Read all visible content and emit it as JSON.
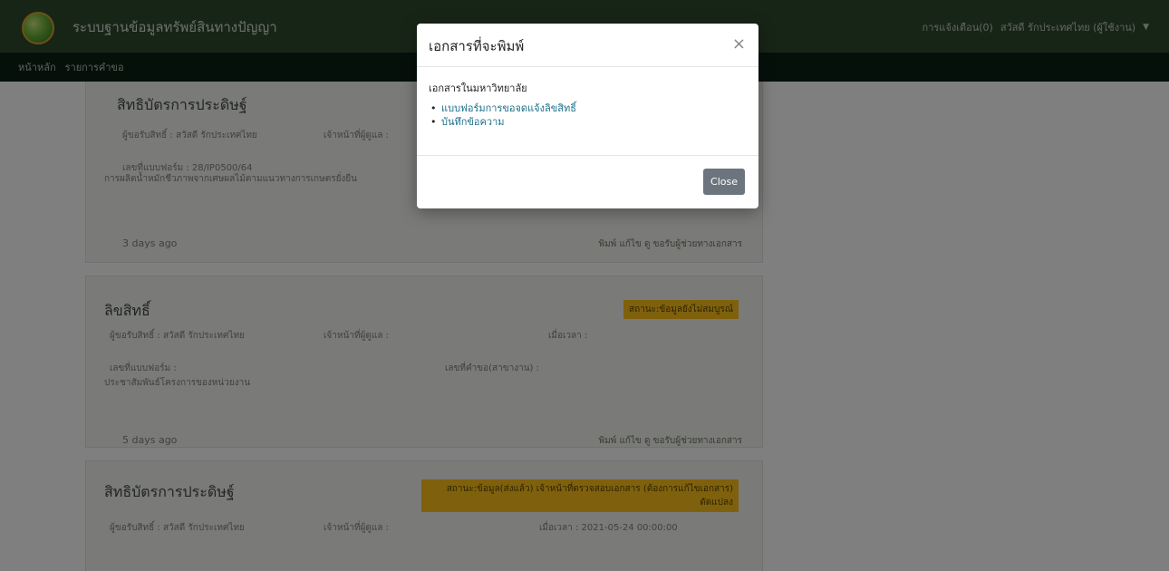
{
  "app": {
    "title": "ระบบฐานข้อมูลทรัพย์สินทางปัญญา",
    "user_label": "การแจ้งเตือน(0)",
    "user_name": "สวัสดี รักประเทศไทย (ผู้ใช้งาน)"
  },
  "subnav": {
    "items": [
      "หน้าหลัก",
      "รายการคำขอ"
    ]
  },
  "feed": [
    {
      "title": "สิทธิบัตรการประดิษฐ์",
      "owner": "ผู้ขอรับสิทธิ์ : สวัสดี รักประเทศไทย",
      "officer": "เจ้าหน้าที่ผู้ดูแล :",
      "form_no": "เลขที่แบบฟอร์ม : 28/IP0500/64",
      "description": "การผลิตน้ำหมักชีวภาพจากเศษผลไม้ตามแนวทางการเกษตรยั่งยืน",
      "ago": "3 days ago",
      "actions": "พิมพ์  แก้ไข  ดู  ขอรับผู้ช่วยทางเอกสาร"
    },
    {
      "title": "ลิขสิทธิ์",
      "badge": "สถานะ:ข้อมูลยังไม่สมบูรณ์",
      "owner": "ผู้ขอรับสิทธิ์ : สวัสดี รักประเทศไทย",
      "officer": "เจ้าหน้าที่ผู้ดูแล :",
      "date": "เมื่อเวลา :",
      "form_no": "เลขที่แบบฟอร์ม :",
      "request_no": "เลขที่คำขอ(สาขางาน) :",
      "description": "ประชาสัมพันธ์โครงการของหน่วยงาน",
      "ago": "5 days ago",
      "actions": "พิมพ์  แก้ไข  ดู  ขอรับผู้ช่วยทางเอกสาร"
    },
    {
      "title": "สิทธิบัตรการประดิษฐ์",
      "badge": "สถานะ:ข้อมูล(ส่งแล้ว) เจ้าหน้าที่ตรวจสอบเอกสาร (ต้องการแก้ไขเอกสาร) ดัดแปลง",
      "owner": "ผู้ขอรับสิทธิ์ : สวัสดี รักประเทศไทย",
      "officer": "เจ้าหน้าที่ผู้ดูแล :",
      "date": "เมื่อเวลา : 2021-05-24 00:00:00"
    }
  ],
  "modal": {
    "title": "เอกสารที่จะพิมพ์",
    "close_icon": "×",
    "section_label": "เอกสารในมหาวิทยาลัย",
    "documents": [
      "แบบฟอร์มการขอจดแจ้งลิขสิทธิ์",
      "บันทึกข้อความ"
    ],
    "close_button": "Close"
  },
  "colors": {
    "navbar": "#2f4a2f",
    "subnav": "#0d2016",
    "badge": "#ffc21a",
    "link": "#1c6f8a",
    "close_button": "#6c757d"
  }
}
